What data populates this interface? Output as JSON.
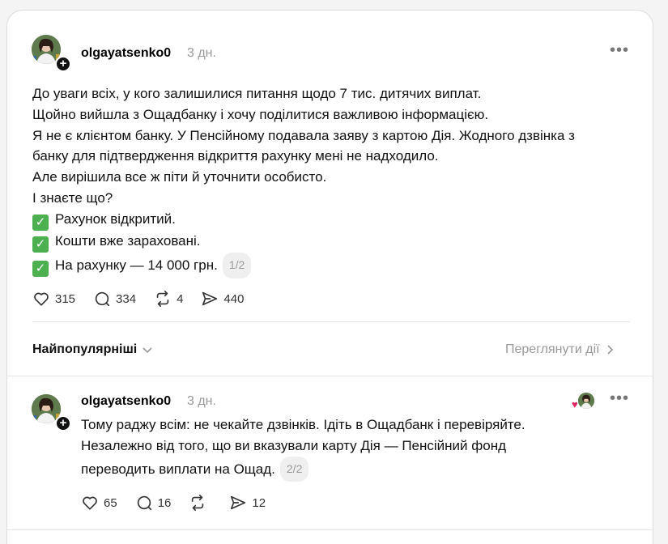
{
  "post1": {
    "username": "olgayatsenko0",
    "time": "3 дн.",
    "lines": [
      "До уваги всіх, у кого залишилися питання щодо 7 тис. дитячих виплат.",
      "Щойно вийшла з Ощадбанку і хочу поділитися важливою інформацією.",
      "Я не є клієнтом банку. У Пенсійному подавала заяву з картою Дія. Жодного дзвінка з",
      "банку для підтвердження відкриття рахунку мені не надходило.",
      "Але вирішила все ж піти й уточнити особисто.",
      "І знаєте що?"
    ],
    "checks": [
      "Рахунок відкритий.",
      "Кошти вже зараховані.",
      "На рахунку — 14 000 грн."
    ],
    "counter": "1/2",
    "likes": "315",
    "comments": "334",
    "reposts": "4",
    "shares": "440"
  },
  "sort": {
    "label": "Найпопулярніші",
    "view_activity": "Переглянути дії"
  },
  "post2": {
    "username": "olgayatsenko0",
    "time": "3 дн.",
    "lines": [
      "Тому раджу всім: не чекайте дзвінків. Ідіть в Ощадбанк і перевіряйте.",
      "Незалежно від того, що ви вказували карту Дія — Пенсійний фонд",
      "переводить виплати на Ощад."
    ],
    "counter": "2/2",
    "likes": "65",
    "comments": "16",
    "reposts": "",
    "shares": "12"
  },
  "icons": {
    "like": "heart-icon",
    "comment": "comment-icon",
    "repost": "repost-icon",
    "share": "share-icon",
    "more": "more-icon",
    "check": "check-icon"
  },
  "colors": {
    "check_green": "#4caf50",
    "muted": "#999999",
    "heart_red": "#e0245e"
  }
}
